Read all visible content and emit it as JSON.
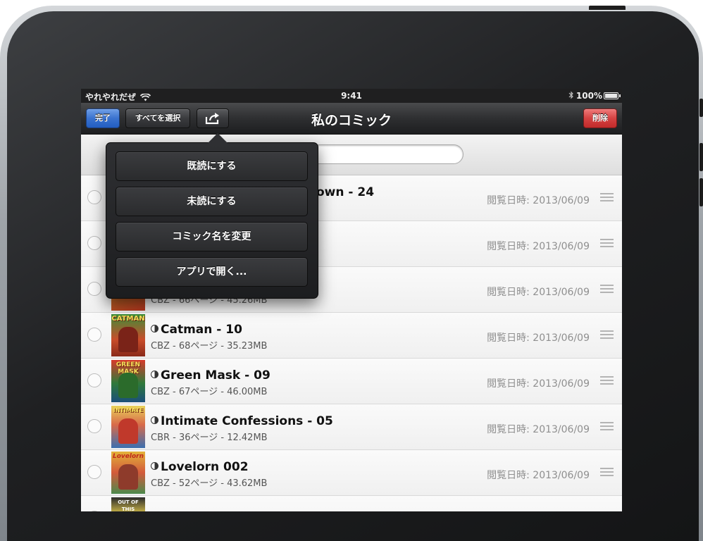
{
  "status_bar": {
    "carrier": "やれやれだぜ",
    "time": "9:41",
    "battery": "100%"
  },
  "nav": {
    "title": "私のコミック",
    "done": "完了",
    "select_all": "すべてを選択",
    "delete": "削除"
  },
  "search": {
    "placeholder": ""
  },
  "popover": {
    "items": [
      {
        "label": "既読にする"
      },
      {
        "label": "未読にする"
      },
      {
        "label": "コミック名を変更"
      },
      {
        "label": "アプリで開く..."
      }
    ]
  },
  "comics": [
    {
      "title": "own - 24",
      "meta": "",
      "date": "閲覧日時: 2013/06/09"
    },
    {
      "title": "",
      "meta": "",
      "date": "閲覧日時: 2013/06/09"
    },
    {
      "title": "",
      "meta": "CBZ - 66ページ - 45.26MB",
      "date": "閲覧日時: 2013/06/09"
    },
    {
      "title": "Catman - 10",
      "meta": "CBZ - 68ページ - 35.23MB",
      "date": "閲覧日時: 2013/06/09",
      "cover": "CATMAN"
    },
    {
      "title": "Green Mask - 09",
      "meta": "CBZ - 67ページ - 46.00MB",
      "date": "閲覧日時: 2013/06/09",
      "cover": "GREEN MASK"
    },
    {
      "title": "Intimate Confessions - 05",
      "meta": "CBR - 36ページ - 12.42MB",
      "date": "閲覧日時: 2013/06/09",
      "cover": "INTIMATE"
    },
    {
      "title": "Lovelorn 002",
      "meta": "CBZ - 52ページ - 43.62MB",
      "date": "閲覧日時: 2013/06/09",
      "cover": "Lovelorn"
    },
    {
      "title": "",
      "meta": "",
      "date": "",
      "cover": "OUT OF THIS WORLD"
    }
  ],
  "colors": {
    "done_button": "#2f6fd3",
    "delete_button": "#d34545",
    "nav_bar": "#2e2f31"
  }
}
